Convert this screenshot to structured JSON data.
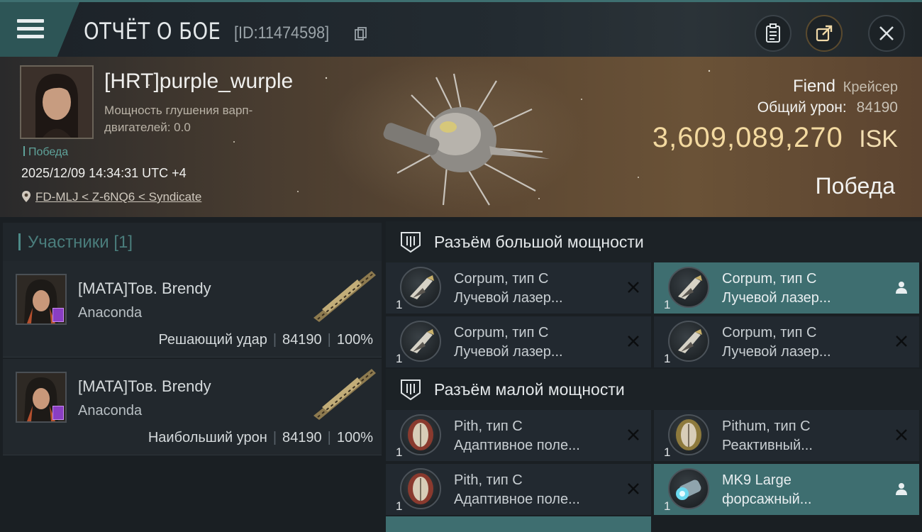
{
  "header": {
    "title": "ОТЧЁТ О БОЕ",
    "report_id": "[ID:11474598]",
    "icons": [
      "menu-icon",
      "copy-icon",
      "clipboard-icon",
      "share-icon",
      "close-icon"
    ]
  },
  "victim": {
    "name": "[HRT]purple_wurple",
    "warp_label": "Мощность глушения варп-двигателей: 0.0",
    "outcome_small": "Победа",
    "datetime": "2025/12/09 14:34:31 UTC +4",
    "location": "FD-MLJ < Z-6NQ6 < Syndicate",
    "ship_name": "Fiend",
    "ship_class": "Крейсер",
    "total_damage_label": "Общий урон:",
    "total_damage_value": "84190",
    "isk_value": "3,609,089,270",
    "isk_unit": "ISK",
    "outcome_big": "Победа"
  },
  "participants": {
    "title": "Участники [1]",
    "items": [
      {
        "name": "[MATA]Тов. Brendy",
        "ship": "Anaconda",
        "role": "Решающий удар",
        "damage": "84190",
        "percent": "100%"
      },
      {
        "name": "[MATA]Тов. Brendy",
        "ship": "Anaconda",
        "role": "Наибольший урон",
        "damage": "84190",
        "percent": "100%"
      }
    ]
  },
  "fitting": {
    "high_slot_title": "Разъём большой мощности",
    "low_slot_title": "Разъём малой мощности",
    "high_modules": [
      {
        "name": "Corpum, тип C",
        "desc": "Лучевой лазер...",
        "qty": "1",
        "status": "destroyed",
        "highlight": false
      },
      {
        "name": "Corpum, тип C",
        "desc": "Лучевой лазер...",
        "qty": "1",
        "status": "dropped",
        "highlight": true
      },
      {
        "name": "Corpum, тип C",
        "desc": "Лучевой лазер...",
        "qty": "1",
        "status": "destroyed",
        "highlight": false
      },
      {
        "name": "Corpum, тип C",
        "desc": "Лучевой лазер...",
        "qty": "1",
        "status": "destroyed",
        "highlight": false
      }
    ],
    "low_modules": [
      {
        "name": "Pith, тип C",
        "desc": "Адаптивное поле...",
        "qty": "1",
        "status": "destroyed",
        "highlight": false
      },
      {
        "name": "Pithum, тип C",
        "desc": "Реактивный...",
        "qty": "1",
        "status": "destroyed",
        "highlight": false
      },
      {
        "name": "Pith, тип C",
        "desc": "Адаптивное поле...",
        "qty": "1",
        "status": "destroyed",
        "highlight": false
      },
      {
        "name": "MK9 Large",
        "desc": "форсажный...",
        "qty": "1",
        "status": "dropped",
        "highlight": true
      }
    ]
  },
  "colors": {
    "accent_teal": "#3e6e70",
    "isk_gold": "#f3d9a0",
    "victory_green": "#5fa39b"
  }
}
